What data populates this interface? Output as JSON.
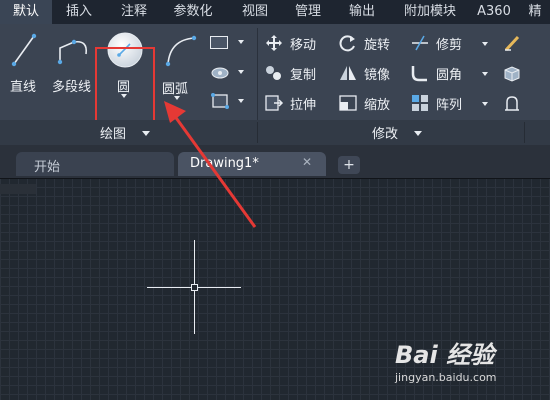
{
  "menu": {
    "tabs": [
      "默认",
      "插入",
      "注释",
      "参数化",
      "视图",
      "管理",
      "输出",
      "附加模块",
      "A360",
      "精"
    ],
    "active_index": 0
  },
  "draw_panel": {
    "title": "绘图",
    "tools": {
      "line": "直线",
      "polyline": "多段线",
      "circle": "圆",
      "arc": "圆弧"
    }
  },
  "modify_panel": {
    "title": "修改",
    "tools": {
      "move": "移动",
      "rotate": "旋转",
      "trim": "修剪",
      "copy": "复制",
      "mirror": "镜像",
      "fillet": "圆角",
      "stretch": "拉伸",
      "scale": "缩放",
      "array": "阵列"
    }
  },
  "file_tabs": {
    "start": "开始",
    "drawing": "Drawing1*"
  },
  "watermark": {
    "brand": "Bai 经验",
    "url": "jingyan.baidu.com"
  },
  "colors": {
    "highlight": "#e53935",
    "ribbon": "#3b4452",
    "canvas": "#212830"
  }
}
